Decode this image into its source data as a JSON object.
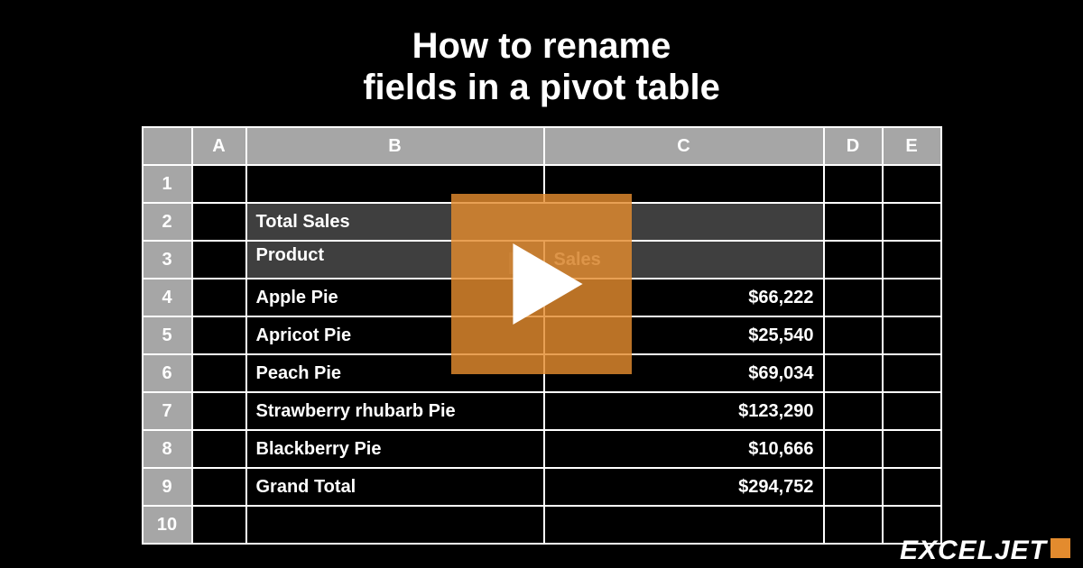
{
  "title_line1": "How to rename",
  "title_line2": "fields in a pivot table",
  "columns": {
    "A": "A",
    "B": "B",
    "C": "C",
    "D": "D",
    "E": "E"
  },
  "row_nums": [
    "1",
    "2",
    "3",
    "4",
    "5",
    "6",
    "7",
    "8",
    "9",
    "10"
  ],
  "pivot": {
    "total_label": "Total Sales",
    "product_label": "Product",
    "sales_label": "Sales",
    "rows": [
      {
        "name": "Apple Pie",
        "value": "$66,222"
      },
      {
        "name": "Apricot Pie",
        "value": "$25,540"
      },
      {
        "name": "Peach Pie",
        "value": "$69,034"
      },
      {
        "name": "Strawberry rhubarb Pie",
        "value": "$123,290"
      },
      {
        "name": "Blackberry Pie",
        "value": "$10,666"
      }
    ],
    "grand_label": "Grand Total",
    "grand_value": "$294,752"
  },
  "logo_text": "EXCELJET"
}
